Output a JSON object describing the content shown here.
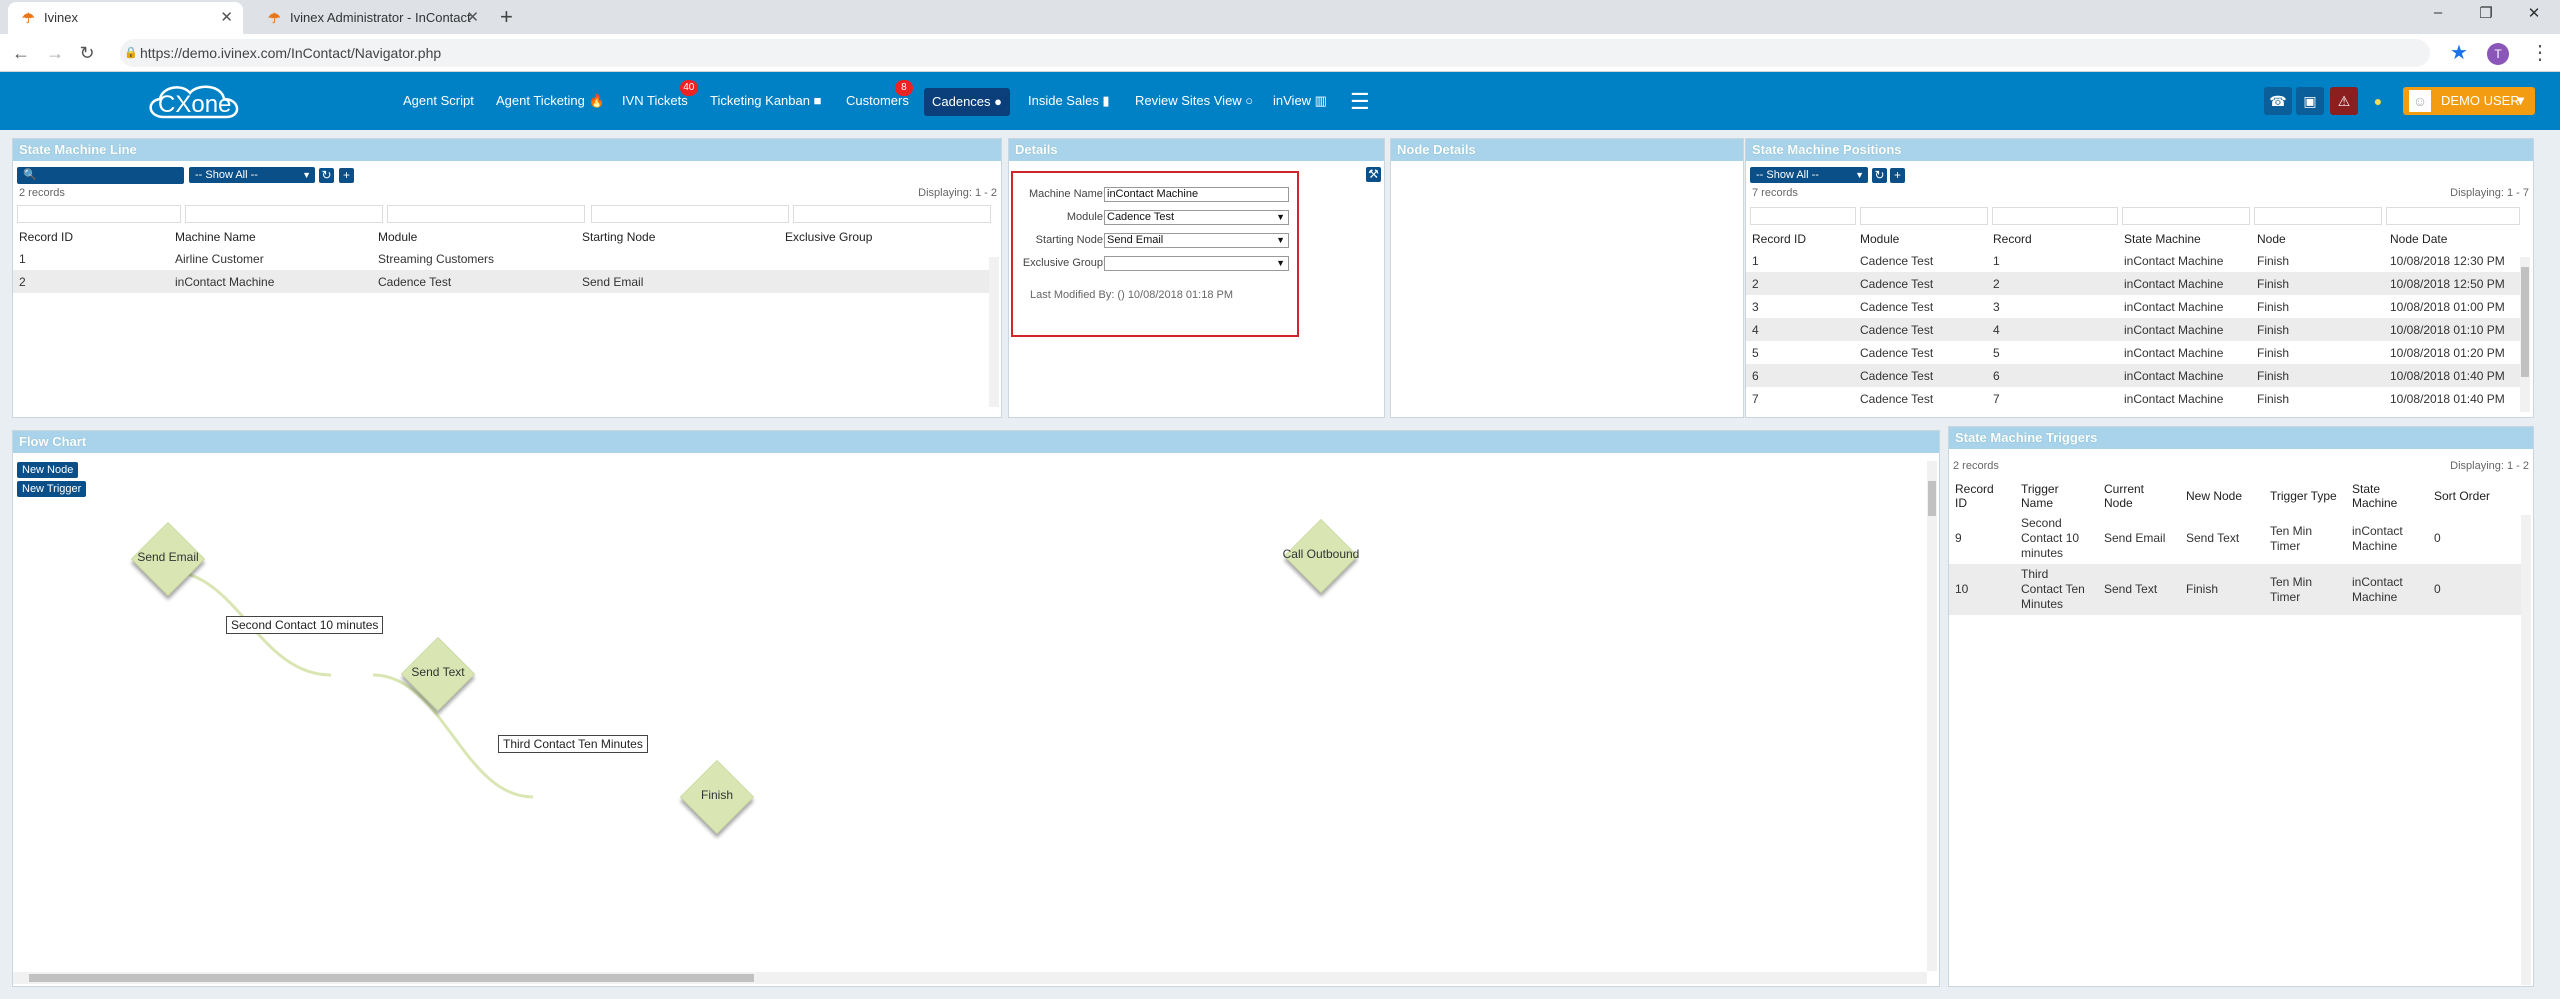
{
  "browser": {
    "tabs": [
      {
        "title": "Ivinex",
        "active": true
      },
      {
        "title": "Ivinex Administrator - InContact",
        "active": false
      }
    ],
    "new_tab": "+",
    "url": "https://demo.ivinex.com/InContact/Navigator.php",
    "avatar_letter": "T"
  },
  "appnav": {
    "logo": "CXone",
    "items": [
      {
        "label": "Agent Script"
      },
      {
        "label": "Agent Ticketing 🔥"
      },
      {
        "label": "IVN Tickets",
        "badge": "40"
      },
      {
        "label": "Ticketing Kanban ■"
      },
      {
        "label": "Customers",
        "badge": "8"
      },
      {
        "label": "Cadences ●",
        "active": true
      },
      {
        "label": "Inside Sales ▮"
      },
      {
        "label": "Review Sites View ○"
      },
      {
        "label": "inView ▥"
      }
    ],
    "user": "DEMO USER",
    "accent": "#0081c5"
  },
  "state_machine_line": {
    "title": "State Machine Line",
    "filter": "-- Show All --",
    "records": "2 records",
    "displaying": "Displaying: 1 - 2",
    "columns": [
      "Record ID",
      "Machine Name",
      "Module",
      "Starting Node",
      "Exclusive Group"
    ],
    "rows": [
      [
        "1",
        "Airline Customer",
        "Streaming Customers",
        "",
        ""
      ],
      [
        "2",
        "inContact Machine",
        "Cadence Test",
        "Send Email",
        ""
      ]
    ]
  },
  "details": {
    "title": "Details",
    "machine_name_label": "Machine Name:",
    "machine_name": "inContact Machine",
    "module_label": "Module:",
    "module": "Cadence Test",
    "starting_node_label": "Starting Node:",
    "starting_node": "Send Email",
    "exclusive_group_label": "Exclusive Group:",
    "exclusive_group": "",
    "last_modified": "Last Modified By: () 10/08/2018 01:18 PM"
  },
  "node_details": {
    "title": "Node Details"
  },
  "positions": {
    "title": "State Machine Positions",
    "filter": "-- Show All --",
    "records": "7 records",
    "displaying": "Displaying: 1 - 7",
    "columns": [
      "Record ID",
      "Module",
      "Record",
      "State Machine",
      "Node",
      "Node Date"
    ],
    "rows": [
      [
        "1",
        "Cadence Test",
        "1",
        "inContact Machine",
        "Finish",
        "10/08/2018 12:30 PM"
      ],
      [
        "2",
        "Cadence Test",
        "2",
        "inContact Machine",
        "Finish",
        "10/08/2018 12:50 PM"
      ],
      [
        "3",
        "Cadence Test",
        "3",
        "inContact Machine",
        "Finish",
        "10/08/2018 01:00 PM"
      ],
      [
        "4",
        "Cadence Test",
        "4",
        "inContact Machine",
        "Finish",
        "10/08/2018 01:10 PM"
      ],
      [
        "5",
        "Cadence Test",
        "5",
        "inContact Machine",
        "Finish",
        "10/08/2018 01:20 PM"
      ],
      [
        "6",
        "Cadence Test",
        "6",
        "inContact Machine",
        "Finish",
        "10/08/2018 01:40 PM"
      ],
      [
        "7",
        "Cadence Test",
        "7",
        "inContact Machine",
        "Finish",
        "10/08/2018 01:40 PM"
      ]
    ]
  },
  "flow_chart": {
    "title": "Flow Chart",
    "new_node": "New Node",
    "new_trigger": "New Trigger",
    "nodes": [
      "Send Email",
      "Send Text",
      "Finish",
      "Call Outbound"
    ],
    "edges": [
      "Second Contact 10 minutes",
      "Third Contact Ten Minutes"
    ]
  },
  "triggers": {
    "title": "State Machine Triggers",
    "records": "2 records",
    "displaying": "Displaying: 1 - 2",
    "columns": [
      "Record ID",
      "Trigger Name",
      "Current Node",
      "New Node",
      "Trigger Type",
      "State Machine",
      "Sort Order"
    ],
    "rows": [
      [
        "9",
        "Second Contact 10 minutes",
        "Send Email",
        "Send Text",
        "Ten Min Timer",
        "inContact Machine",
        "0"
      ],
      [
        "10",
        "Third Contact Ten Minutes",
        "Send Text",
        "Finish",
        "Ten Min Timer",
        "inContact Machine",
        "0"
      ]
    ]
  }
}
